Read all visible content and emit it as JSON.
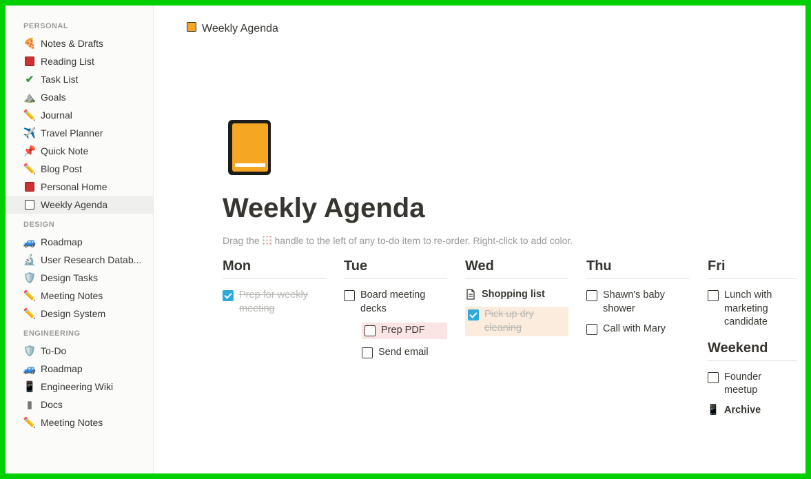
{
  "breadcrumb": {
    "label": "Weekly Agenda"
  },
  "page": {
    "title": "Weekly Agenda",
    "hint_before": "Drag the ",
    "hint_after": " handle to the left of any to-do item to re-order. Right-click to add color."
  },
  "sidebar": {
    "sections": [
      {
        "title": "PERSONAL",
        "items": [
          {
            "icon": "pizza",
            "label": "Notes & Drafts"
          },
          {
            "icon": "redbook",
            "label": "Reading List"
          },
          {
            "icon": "check",
            "label": "Task List"
          },
          {
            "icon": "mountain",
            "label": "Goals"
          },
          {
            "icon": "pencilgr",
            "label": "Journal"
          },
          {
            "icon": "plane",
            "label": "Travel Planner"
          },
          {
            "icon": "pin",
            "label": "Quick Note"
          },
          {
            "icon": "pencilye",
            "label": "Blog Post"
          },
          {
            "icon": "redbook",
            "label": "Personal Home"
          },
          {
            "icon": "notebook",
            "label": "Weekly Agenda",
            "active": true
          }
        ]
      },
      {
        "title": "DESIGN",
        "items": [
          {
            "icon": "car",
            "label": "Roadmap"
          },
          {
            "icon": "micro",
            "label": "User Research Datab..."
          },
          {
            "icon": "shield",
            "label": "Design Tasks"
          },
          {
            "icon": "pencilye",
            "label": "Meeting Notes"
          },
          {
            "icon": "pencilgr",
            "label": "Design System"
          }
        ]
      },
      {
        "title": "ENGINEERING",
        "items": [
          {
            "icon": "shield",
            "label": "To-Do"
          },
          {
            "icon": "car",
            "label": "Roadmap"
          },
          {
            "icon": "phone",
            "label": "Engineering Wiki"
          },
          {
            "icon": "docgray",
            "label": "Docs"
          },
          {
            "icon": "pencilye",
            "label": "Meeting Notes"
          }
        ]
      }
    ]
  },
  "cols": {
    "mon": {
      "heading": "Mon",
      "items": [
        {
          "type": "todo",
          "label": "Prep for weekly meeting",
          "checked": true
        }
      ]
    },
    "tue": {
      "heading": "Tue",
      "items": [
        {
          "type": "todo",
          "label": "Board meeting decks",
          "checked": false
        },
        {
          "type": "todo",
          "label": "Prep PDF",
          "checked": false,
          "indent": true,
          "hl": "pink"
        },
        {
          "type": "todo",
          "label": "Send email",
          "checked": false,
          "indent": true
        }
      ]
    },
    "wed": {
      "heading": "Wed",
      "items": [
        {
          "type": "page",
          "label": "Shopping list"
        },
        {
          "type": "todo",
          "label": "Pick up dry cleaning",
          "checked": true,
          "hl": "peach"
        }
      ]
    },
    "thu": {
      "heading": "Thu",
      "items": [
        {
          "type": "todo",
          "label": "Shawn's baby shower",
          "checked": false
        },
        {
          "type": "todo",
          "label": "Call with Mary",
          "checked": false
        }
      ]
    },
    "fri": {
      "heading": "Fri",
      "items": [
        {
          "type": "todo",
          "label": "Lunch with marketing candidate",
          "checked": false
        }
      ],
      "sub_heading": "Weekend",
      "sub_items": [
        {
          "type": "todo",
          "label": "Founder meetup",
          "checked": false
        },
        {
          "type": "page",
          "label": "Archive",
          "icon": "phone"
        }
      ]
    }
  }
}
